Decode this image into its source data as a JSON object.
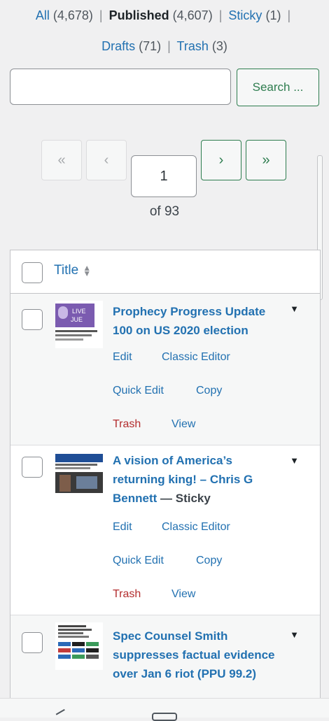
{
  "filters": {
    "all_label": "All",
    "all_count": "(4,678)",
    "published_label": "Published",
    "published_count": "(4,607)",
    "sticky_label": "Sticky",
    "sticky_count": "(1)",
    "drafts_label": "Drafts",
    "drafts_count": "(71)",
    "trash_label": "Trash",
    "trash_count": "(3)",
    "separator": "|"
  },
  "search": {
    "value": "",
    "button_label": "Search ..."
  },
  "pagination": {
    "first": "«",
    "prev": "‹",
    "next": "›",
    "last": "»",
    "current_page": "1",
    "of_text": "of 93"
  },
  "table": {
    "title_header": "Title",
    "sort_icon": "sort-icon",
    "toggle_icon": "▼",
    "rows": [
      {
        "title": "Prophecy Progress Update 100 on US 2020 election",
        "state": "",
        "actions": {
          "edit": "Edit",
          "classic": "Classic Editor",
          "quick": "Quick Edit",
          "copy": "Copy",
          "trash": "Trash",
          "view": "View"
        }
      },
      {
        "title": "A vision of America’s returning king! – Chris G Bennett",
        "state": "— Sticky",
        "actions": {
          "edit": "Edit",
          "classic": "Classic Editor",
          "quick": "Quick Edit",
          "copy": "Copy",
          "trash": "Trash",
          "view": "View"
        }
      },
      {
        "title": "Spec Counsel Smith suppresses factual evidence over Jan 6 riot (PPU 99.2)",
        "state": "",
        "actions": {}
      }
    ]
  },
  "colors": {
    "link": "#2271b1",
    "trash": "#b32d2e",
    "accent_green": "#2e7d4f",
    "background": "#f0f0f1"
  }
}
